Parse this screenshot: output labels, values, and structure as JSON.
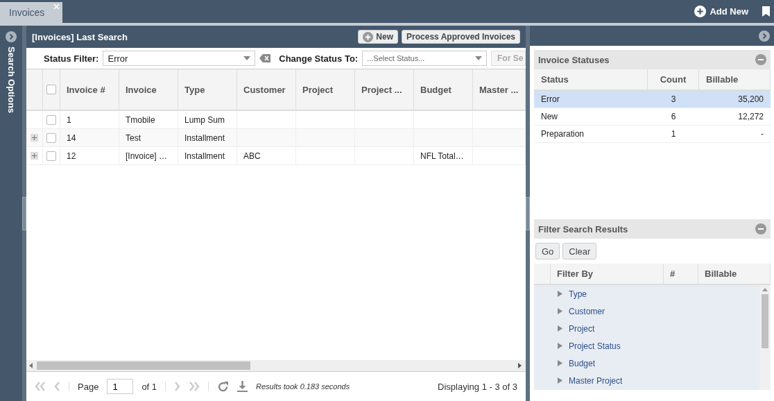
{
  "tabs": [
    {
      "label": "Invoices",
      "selected": true
    }
  ],
  "top_actions": {
    "add_new": "Add New"
  },
  "sidebar": {
    "title": "Search Options"
  },
  "search_panel": {
    "title": "[Invoices] Last Search",
    "buttons": [
      "New",
      "Process Approved Invoices"
    ],
    "status_filter": {
      "label": "Status Filter:",
      "value": "Error"
    },
    "change_status": {
      "label": "Change Status To:",
      "placeholder": "...Select Status...",
      "button": "For Se",
      "button_disabled": true
    },
    "table": {
      "select_all_checked": false,
      "columns": [
        "Invoice #",
        "Invoice",
        "Type",
        "Customer",
        "Project",
        "Project ...",
        "Budget",
        "Master ..."
      ],
      "rows": [
        {
          "expandable": false,
          "checked": false,
          "cells": [
            "1",
            "Tmobile",
            "Lump Sum",
            "",
            "",
            "",
            "",
            ""
          ]
        },
        {
          "expandable": true,
          "checked": false,
          "cells": [
            "14",
            "Test",
            "Installment",
            "",
            "",
            "",
            "",
            ""
          ]
        },
        {
          "expandable": true,
          "checked": false,
          "cells": [
            "12",
            "[Invoice] …",
            "Installment",
            "ABC",
            "",
            "",
            "NFL Total…",
            ""
          ]
        }
      ]
    },
    "pager": {
      "page_label": "Page",
      "page": "1",
      "of": "of 1",
      "timing": "Results took 0.183 seconds",
      "displaying": "Displaying 1 - 3 of 3"
    }
  },
  "invoice_statuses": {
    "title": "Invoice Statuses",
    "columns": [
      "Status",
      "Count",
      "Billable"
    ],
    "rows": [
      {
        "status": "Error",
        "count": "3",
        "billable": "35,200",
        "selected": true
      },
      {
        "status": "New",
        "count": "6",
        "billable": "12,272",
        "selected": false
      },
      {
        "status": "Preparation",
        "count": "1",
        "billable": "-",
        "selected": false
      }
    ]
  },
  "filter_results": {
    "title": "Filter Search Results",
    "buttons": [
      "Go",
      "Clear"
    ],
    "columns": [
      "Filter By",
      "#",
      "Billable"
    ],
    "items": [
      {
        "label": "Type",
        "expanded": false
      },
      {
        "label": "Customer",
        "expanded": false
      },
      {
        "label": "Project",
        "expanded": false
      },
      {
        "label": "Project Status",
        "expanded": false
      },
      {
        "label": "Budget",
        "expanded": false
      },
      {
        "label": "Master Project",
        "expanded": false
      }
    ]
  }
}
